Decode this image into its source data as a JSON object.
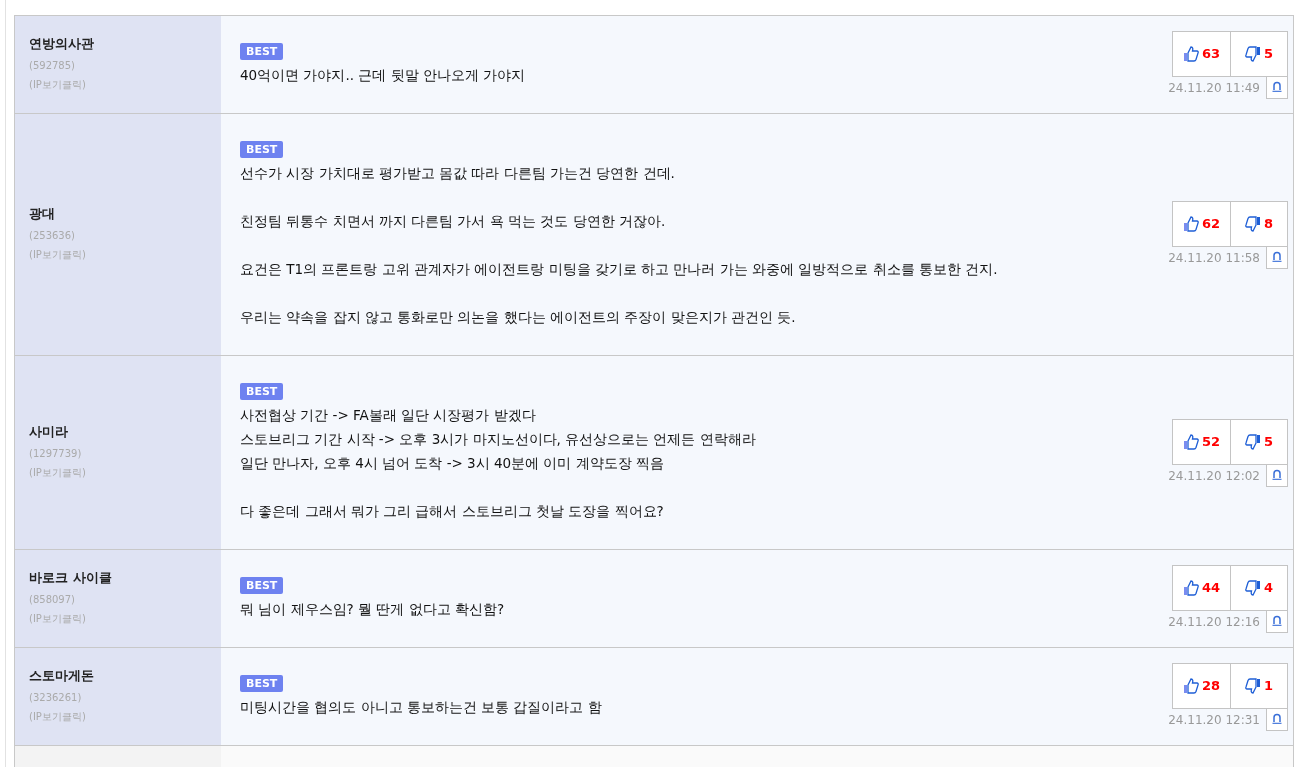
{
  "comments": [
    {
      "author": "연방의사관",
      "user_id": "(592785)",
      "ip_link": "(IP보기클릭)",
      "badge": "BEST",
      "paragraphs": [
        [
          "40억이면 가야지.. 근데 뒷말 안나오게 가야지"
        ]
      ],
      "likes": "63",
      "dislikes": "5",
      "time": "24.11.20 11:49"
    },
    {
      "author": "광대",
      "user_id": "(253636)",
      "ip_link": "(IP보기클릭)",
      "badge": "BEST",
      "paragraphs": [
        [
          "선수가 시장 가치대로 평가받고 몸값 따라 다른팀 가는건 당연한 건데."
        ],
        [
          "친정팀 뒤통수 치면서 까지 다른팀 가서 욕 먹는 것도 당연한 거잖아."
        ],
        [
          "요건은 T1의 프론트랑 고위 관계자가 에이전트랑 미팅을 갖기로 하고 만나러 가는 와중에 일방적으로 취소를 통보한 건지."
        ],
        [
          "우리는 약속을 잡지 않고 통화로만 의논을 했다는 에이전트의 주장이 맞은지가 관건인 듯."
        ]
      ],
      "likes": "62",
      "dislikes": "8",
      "time": "24.11.20 11:58"
    },
    {
      "author": "사미라",
      "user_id": "(1297739)",
      "ip_link": "(IP보기클릭)",
      "badge": "BEST",
      "paragraphs": [
        [
          "사전협상 기간 -> FA볼래 일단 시장평가 받겠다",
          "스토브리그 기간 시작 -> 오후 3시가 마지노선이다, 유선상으로는 언제든 연락해라",
          "일단 만나자, 오후 4시 넘어 도착 -> 3시 40분에 이미 계약도장 찍음"
        ],
        [
          "다 좋은데 그래서 뭐가 그리 급해서 스토브리그 첫날 도장을 찍어요?"
        ]
      ],
      "likes": "52",
      "dislikes": "5",
      "time": "24.11.20 12:02"
    },
    {
      "author": "바로크 사이클",
      "user_id": "(858097)",
      "ip_link": "(IP보기클릭)",
      "badge": "BEST",
      "paragraphs": [
        [
          "뭐 님이 제우스임? 뭘 딴게 없다고 확신함?"
        ]
      ],
      "likes": "44",
      "dislikes": "4",
      "time": "24.11.20 12:16"
    },
    {
      "author": "스토마게돈",
      "user_id": "(3236261)",
      "ip_link": "(IP보기클릭)",
      "badge": "BEST",
      "paragraphs": [
        [
          "미팅시간을 협의도 아니고 통보하는건 보통 갑질이라고 함"
        ]
      ],
      "likes": "28",
      "dislikes": "1",
      "time": "24.11.20 12:31"
    }
  ]
}
